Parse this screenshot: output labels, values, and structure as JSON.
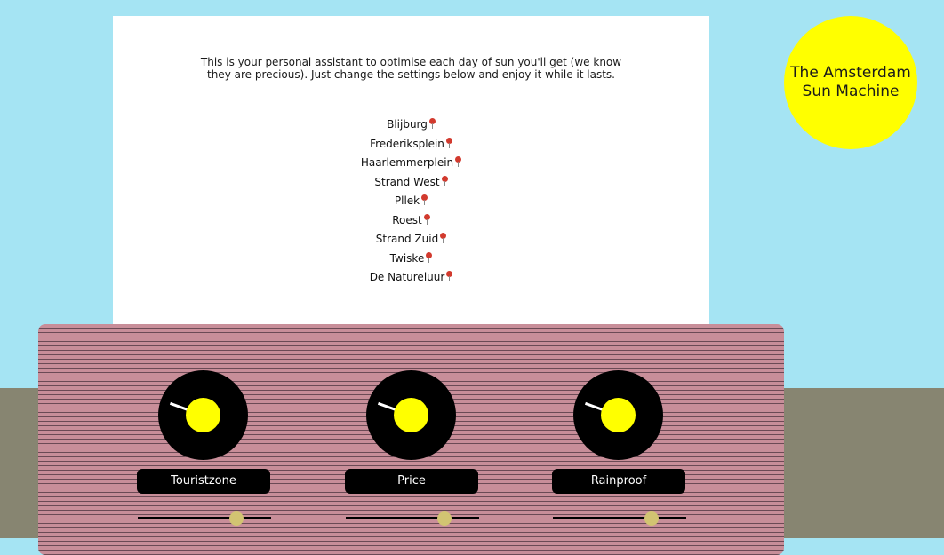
{
  "intro_text": "This is your personal assistant to optimise each day of sun you'll get (we know they are precious). Just change the settings below and enjoy it while it lasts.",
  "logo": {
    "line1": "The Amsterdam",
    "line2": "Sun Machine"
  },
  "places": [
    {
      "name": "Blijburg",
      "icon": "map-pin-icon"
    },
    {
      "name": "Frederiksplein",
      "icon": "map-pin-icon"
    },
    {
      "name": "Haarlemmerplein",
      "icon": "map-pin-icon"
    },
    {
      "name": "Strand West",
      "icon": "map-pin-icon"
    },
    {
      "name": "Pllek",
      "icon": "map-pin-icon"
    },
    {
      "name": "Roest",
      "icon": "map-pin-icon"
    },
    {
      "name": "Strand Zuid",
      "icon": "map-pin-icon"
    },
    {
      "name": "Twiske",
      "icon": "map-pin-icon"
    },
    {
      "name": "De Natureluur",
      "icon": "map-pin-icon"
    }
  ],
  "controls": [
    {
      "label": "Touristzone",
      "slider_fraction": 0.77
    },
    {
      "label": "Price",
      "slider_fraction": 0.77
    },
    {
      "label": "Rainproof",
      "slider_fraction": 0.77
    }
  ],
  "colors": {
    "sky": "#a5e4f3",
    "ground": "#878571",
    "sun": "#ffff00",
    "console": "#c88e99",
    "slider_thumb": "#d2c472",
    "pin": "#d23a2e"
  }
}
